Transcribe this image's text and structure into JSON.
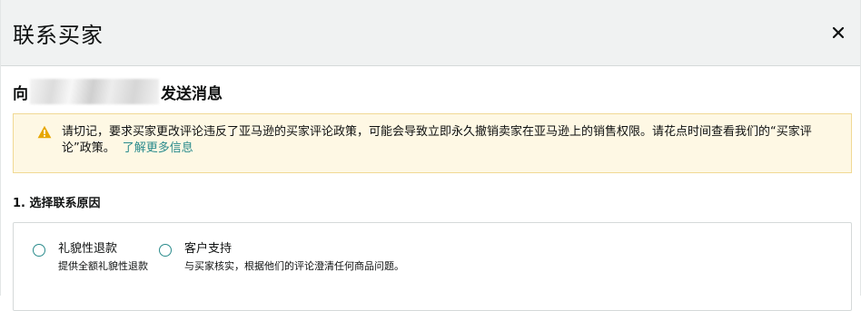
{
  "header": {
    "title": "联系买家",
    "close_icon": "close-icon"
  },
  "send_to": {
    "prefix": "向",
    "suffix": "发送消息"
  },
  "alert": {
    "icon": "warning-icon",
    "icon_color": "#e7a700",
    "text": "请切记，要求买家更改评论违反了亚马逊的买家评论政策，可能会导致立即永久撤销卖家在亚马逊上的销售权限。请花点时间查看我们的“买家评论”政策。",
    "link": "了解更多信息"
  },
  "reason": {
    "label": "1. 选择联系原因",
    "options": [
      {
        "label": "礼貌性退款",
        "description": "提供全额礼貌性退款"
      },
      {
        "label": "客户支持",
        "description": "与买家核实，根据他们的评论澄清任何商品问题。"
      }
    ]
  },
  "colors": {
    "accent": "#2a8b8c",
    "alert_bg": "#fef8e4",
    "alert_border": "#f1d994"
  }
}
